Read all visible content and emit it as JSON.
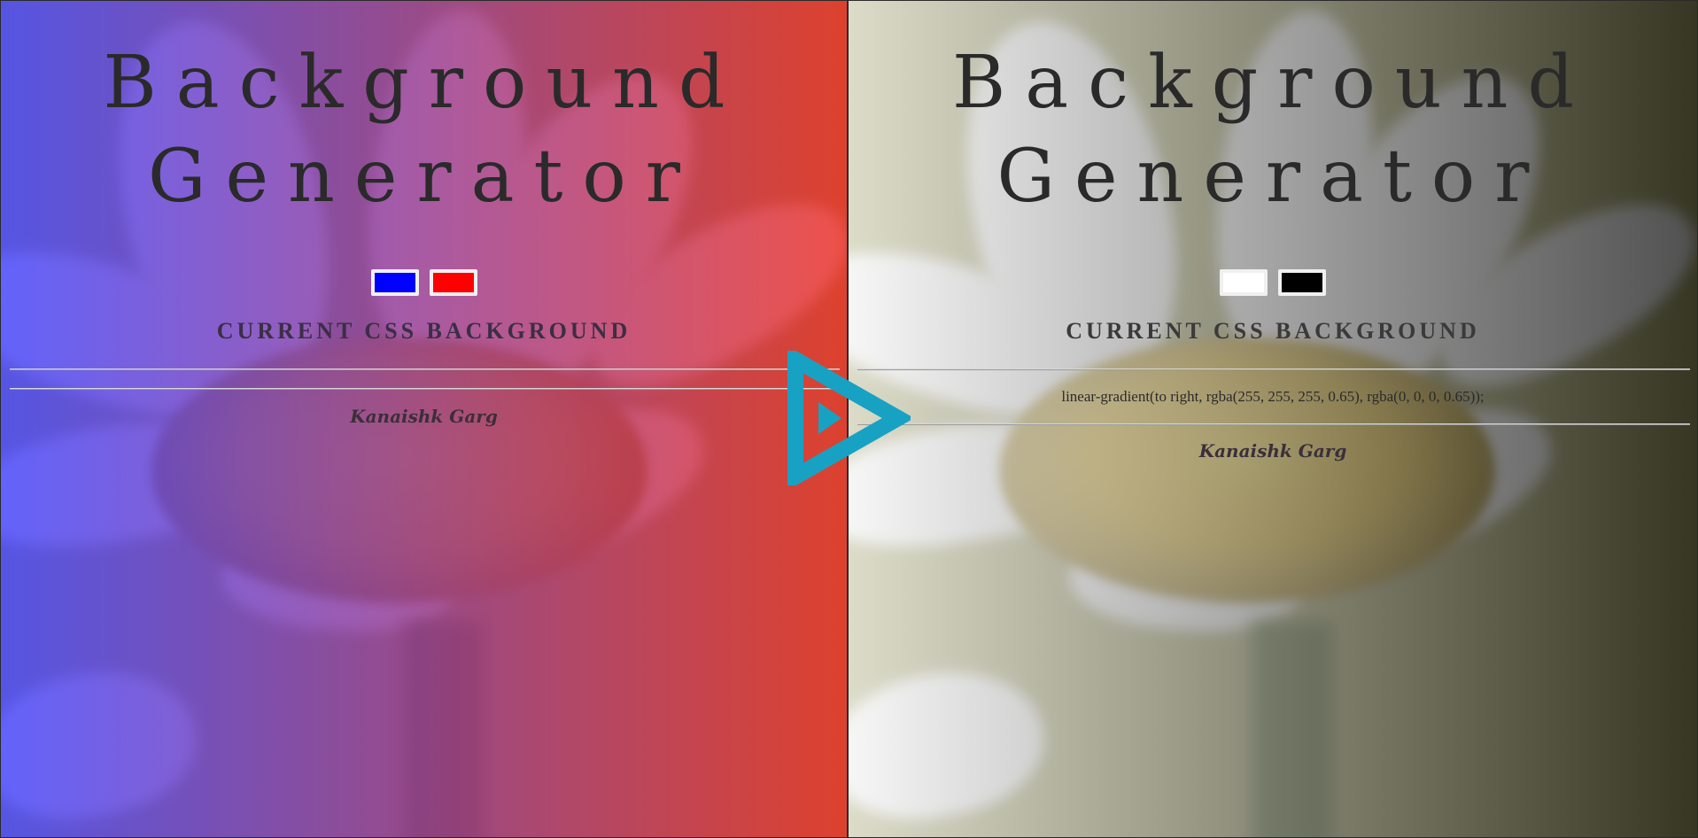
{
  "panels": {
    "before": {
      "title_line1": "Background",
      "title_line2": "Generator",
      "color1": "#0000ff",
      "color2": "#ff0000",
      "subtitle": "CURRENT CSS BACKGROUND",
      "css_text": "",
      "author": "Kanaishk Garg"
    },
    "after": {
      "title_line1": "Background",
      "title_line2": "Generator",
      "color1": "#ffffff",
      "color2": "#000000",
      "subtitle": "CURRENT CSS BACKGROUND",
      "css_text": "linear-gradient(to right, rgba(255, 255, 255, 0.65), rgba(0, 0, 0, 0.65));",
      "author": "Kanaishk Garg"
    }
  },
  "arrow_icon": "play-arrow-icon",
  "arrow_color": "#17a2c4"
}
